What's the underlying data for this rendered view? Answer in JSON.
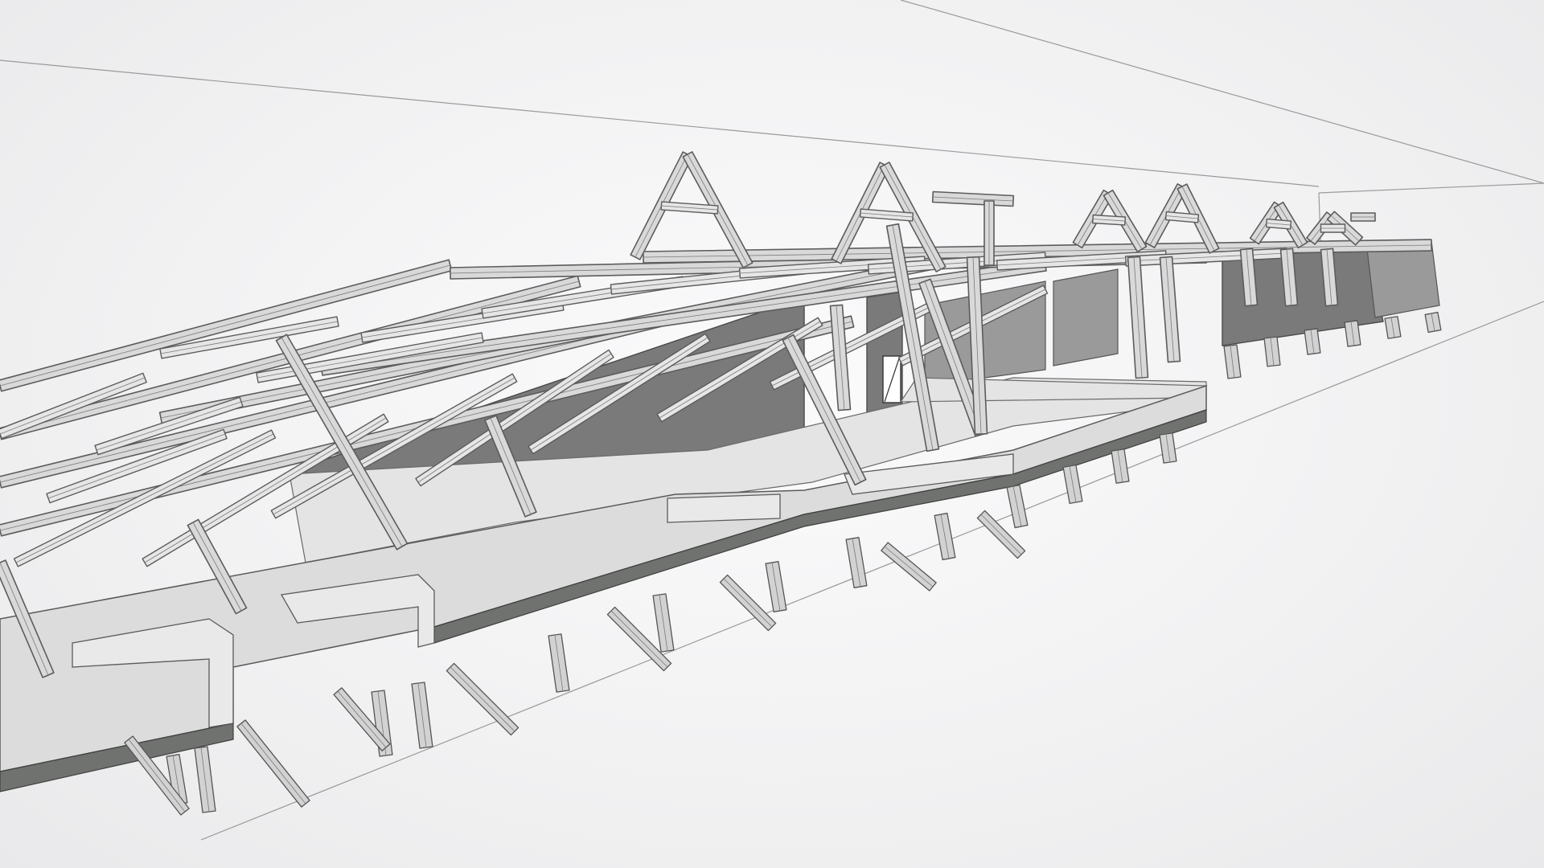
{
  "viewport": {
    "background": "#f2f2f3",
    "model_fill": "#d9d9d9",
    "model_stroke": "#5c5c5c",
    "wall_fill": "#7a7a7a",
    "slab_edge": "#6f726f"
  }
}
